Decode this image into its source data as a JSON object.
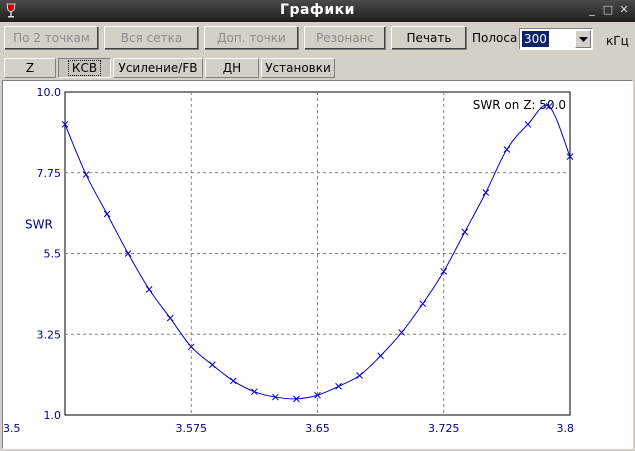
{
  "window": {
    "title": "Графики"
  },
  "toolbar": {
    "buttons": [
      {
        "label": "По 2 точкам",
        "enabled": false
      },
      {
        "label": "Вся сетка",
        "enabled": false
      },
      {
        "label": "Доп. точки",
        "enabled": false
      },
      {
        "label": "Резонанс",
        "enabled": false
      },
      {
        "label": "Печать",
        "enabled": true
      }
    ],
    "band_label": "Полоса",
    "band_value": "300",
    "band_unit": "кГц"
  },
  "tabs": [
    {
      "label": "Z",
      "active": false
    },
    {
      "label": "КСВ",
      "active": true
    },
    {
      "label": "Усиление/FB",
      "active": false
    },
    {
      "label": "ДН",
      "active": false
    },
    {
      "label": "Установки",
      "active": false
    }
  ],
  "colors": {
    "series": "#0000cc",
    "axis_text": "#00008b",
    "grid": "#808080"
  },
  "chart_data": {
    "type": "line",
    "annotation": "SWR on Z: 50.0",
    "ylabel": "SWR",
    "xlabel": "",
    "xlim": [
      3.5,
      3.8
    ],
    "ylim": [
      1.0,
      10.0
    ],
    "x_ticks": [
      "3.5",
      "3.575",
      "3.65",
      "3.725",
      "3.8"
    ],
    "y_ticks": [
      "1.0",
      "3.25",
      "5.5",
      "7.75",
      "10.0"
    ],
    "grid": true,
    "series": [
      {
        "marker": "x",
        "x": [
          3.5,
          3.5125,
          3.525,
          3.5375,
          3.55,
          3.5625,
          3.575,
          3.5875,
          3.6,
          3.6125,
          3.625,
          3.6375,
          3.65,
          3.6625,
          3.675,
          3.6875,
          3.7,
          3.7125,
          3.725,
          3.7375,
          3.75,
          3.7625,
          3.775,
          3.7875,
          3.8
        ],
        "y": [
          9.1,
          7.7,
          6.6,
          5.5,
          4.5,
          3.7,
          2.9,
          2.4,
          1.95,
          1.65,
          1.5,
          1.45,
          1.55,
          1.8,
          2.1,
          2.65,
          3.3,
          4.1,
          5.0,
          6.1,
          7.2,
          8.4,
          9.1,
          9.6,
          8.2
        ]
      }
    ]
  }
}
